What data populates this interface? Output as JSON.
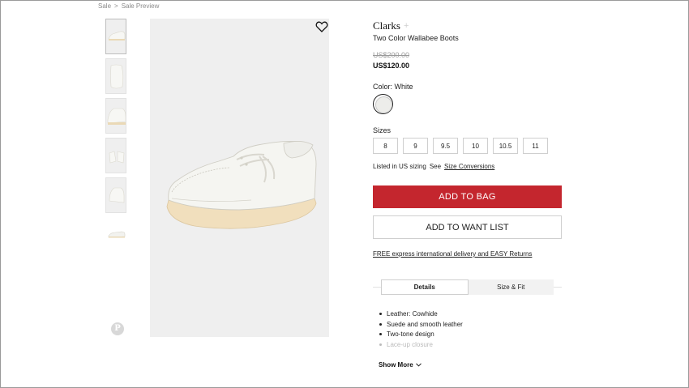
{
  "breadcrumb": {
    "items": [
      "Sale",
      ">",
      "Sale Preview"
    ]
  },
  "gallery": {
    "thumbnail_count": 6,
    "icons": {
      "wishlist": "heart-icon",
      "pin": "pinterest-icon"
    }
  },
  "product": {
    "brand": "Clarks",
    "brand_follow": "+",
    "name": "Two Color Wallabee Boots",
    "price_original": "US$200.00",
    "price_sale": "US$120.00",
    "color_label": "Color: White",
    "sizes_label": "Sizes",
    "sizes": [
      "8",
      "9",
      "9.5",
      "10",
      "10.5",
      "11"
    ],
    "sizing_note": "Listed in US sizing",
    "sizing_see": "See",
    "sizing_link": "Size Conversions",
    "add_to_bag": "ADD TO BAG",
    "add_to_want_list": "ADD TO WANT LIST",
    "shipping_note": "FREE express international delivery and EASY Returns"
  },
  "tabs": [
    {
      "label": "Details",
      "active": true
    },
    {
      "label": "Size & Fit",
      "active": false
    }
  ],
  "details": {
    "items": [
      "Leather: Cowhide",
      "Suede and smooth leather",
      "Two-tone design",
      "Lace-up closure"
    ],
    "show_more": "Show More"
  },
  "colors": {
    "accent": "#c4262e",
    "swatch": "#ededea"
  }
}
